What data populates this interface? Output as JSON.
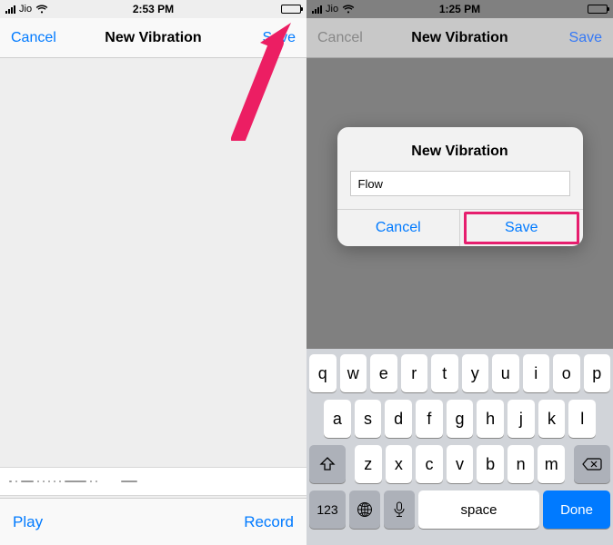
{
  "left": {
    "status": {
      "carrier": "Jio",
      "time": "2:53 PM"
    },
    "nav": {
      "cancel": "Cancel",
      "title": "New Vibration",
      "save": "Save"
    },
    "bottom": {
      "play": "Play",
      "record": "Record"
    }
  },
  "right": {
    "status": {
      "carrier": "Jio",
      "time": "1:25 PM"
    },
    "nav": {
      "cancel": "Cancel",
      "title": "New Vibration",
      "save": "Save"
    },
    "popup": {
      "title": "New Vibration",
      "input_value": "Flow",
      "cancel": "Cancel",
      "save": "Save"
    },
    "keyboard": {
      "row1": [
        "q",
        "w",
        "e",
        "r",
        "t",
        "y",
        "u",
        "i",
        "o",
        "p"
      ],
      "row2": [
        "a",
        "s",
        "d",
        "f",
        "g",
        "h",
        "j",
        "k",
        "l"
      ],
      "row3": [
        "z",
        "x",
        "c",
        "v",
        "b",
        "n",
        "m"
      ],
      "numkey": "123",
      "space": "space",
      "done": "Done"
    }
  }
}
